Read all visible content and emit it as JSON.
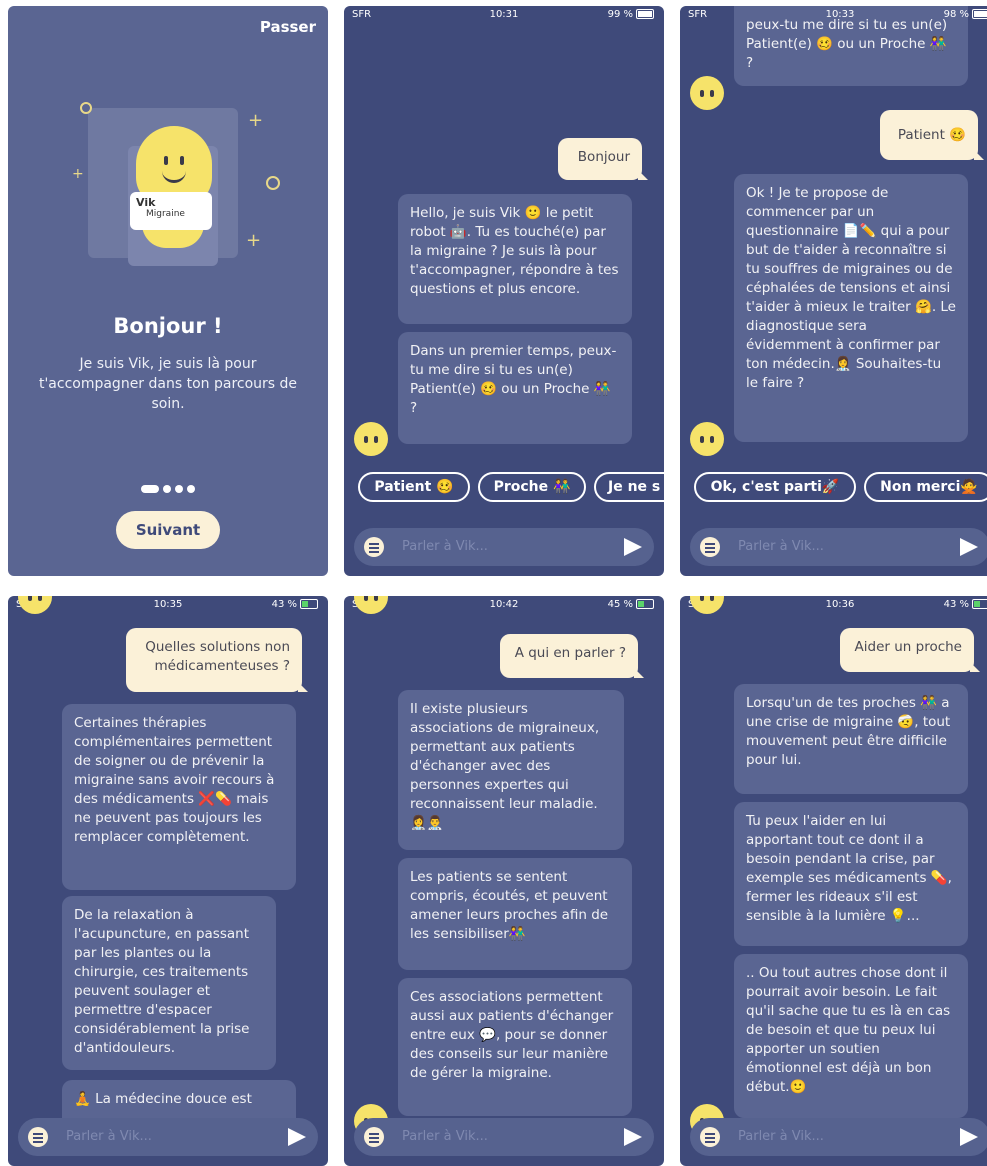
{
  "screen1": {
    "skip": "Passer",
    "shirt_name": "Vik",
    "shirt_sub": "Migraine",
    "title": "Bonjour !",
    "description": "Je suis Vik, je suis là pour t'accompagner dans ton parcours de soin.",
    "next": "Suivant"
  },
  "screen2": {
    "status": {
      "carrier": "SFR",
      "time": "10:31",
      "battery": "99 %"
    },
    "user_msg": "Bonjour",
    "bot_msg1": "Hello, je suis Vik 🙂 le petit robot 🤖. Tu es touché(e) par la migraine ? Je suis là pour t'accompagner, répondre à tes questions et plus encore.",
    "bot_msg2": "Dans un premier temps, peux-tu me dire si tu es un(e) Patient(e) 🥴 ou un Proche 👫 ?",
    "chips": [
      "Patient 🥴",
      "Proche 👫",
      "Je ne s"
    ],
    "input_placeholder": "Parler à Vik..."
  },
  "screen3": {
    "status": {
      "carrier": "SFR",
      "time": "10:33",
      "battery": "98 %"
    },
    "bot_msg_top": "peux-tu me dire si tu es un(e) Patient(e) 🥴 ou un Proche 👫 ?",
    "user_msg": "Patient 🥴",
    "bot_msg": "Ok ! Je te propose de commencer par un questionnaire 📄✏️ qui a pour but de t'aider à reconnaître si tu souffres de migraines ou de céphalées de tensions et ainsi t'aider à mieux le traiter 🤗. Le diagnostique sera évidemment à confirmer par ton médecin.👩‍⚕️ Souhaites-tu le faire ?",
    "chips": [
      "Ok, c'est parti🚀",
      "Non merci🙅"
    ],
    "input_placeholder": "Parler à Vik..."
  },
  "screen4": {
    "status": {
      "carrier": "SFR",
      "time": "10:35",
      "battery": "43 %"
    },
    "user_msg": "Quelles solutions non médicamenteuses ?",
    "bot_msg1": "Certaines thérapies complémentaires permettent de soigner ou de prévenir la migraine sans avoir recours à des médicaments ❌💊 mais ne peuvent pas toujours les remplacer complètement.",
    "bot_msg2": "De la relaxation à l'acupuncture, en passant par les plantes ou la chirurgie, ces traitements peuvent soulager et permettre d'espacer considérablement la prise d'antidouleurs.",
    "bot_msg3": "🧘 La médecine douce est",
    "input_placeholder": "Parler à Vik..."
  },
  "screen5": {
    "status": {
      "carrier": "SFR",
      "time": "10:42",
      "battery": "45 %"
    },
    "user_msg": "A qui en parler ?",
    "bot_msg1": "Il existe plusieurs associations de migraineux, permettant aux patients d'échanger avec des personnes expertes qui reconnaissent leur maladie.👩‍⚕️👨‍⚕️",
    "bot_msg2": "Les patients se sentent compris, écoutés, et peuvent amener leurs proches afin de les sensibiliser👫",
    "bot_msg3": "Ces associations permettent aussi aux patients d'échanger entre eux 💬, pour se donner des conseils sur leur manière de gérer la migraine.",
    "input_placeholder": "Parler à Vik..."
  },
  "screen6": {
    "status": {
      "carrier": "SFR",
      "time": "10:36",
      "battery": "43 %"
    },
    "user_msg": "Aider un proche",
    "bot_msg1": "Lorsqu'un de tes proches 👫 a une crise de migraine 🤕, tout mouvement peut être difficile pour lui.",
    "bot_msg2": "Tu peux l'aider en lui apportant tout ce dont il a besoin pendant la crise, par exemple ses médicaments 💊, fermer les rideaux s'il est sensible à la lumière 💡...",
    "bot_msg3": ".. Ou tout autres chose dont il pourrait avoir besoin. Le fait qu'il sache que tu es là en cas de besoin et que tu peux lui apporter un soutien émotionnel est déjà un bon début.🙂",
    "input_placeholder": "Parler à Vik..."
  },
  "colors": {
    "background": "#3f4a7a",
    "bot_bubble": "#5a6592",
    "user_bubble": "#fbf1d8",
    "mascot": "#f6e36a"
  }
}
